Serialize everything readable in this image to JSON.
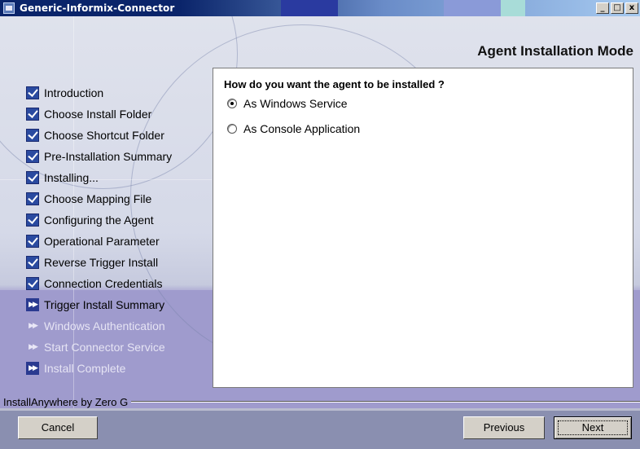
{
  "window": {
    "title": "Generic-Informix-Connector",
    "controls": {
      "minimize": "_",
      "maximize": "□",
      "close": "x"
    }
  },
  "page": {
    "heading": "Agent Installation Mode"
  },
  "steps": [
    {
      "label": "Introduction",
      "state": "done",
      "icon": "check-icon"
    },
    {
      "label": "Choose Install Folder",
      "state": "done",
      "icon": "check-icon"
    },
    {
      "label": "Choose Shortcut Folder",
      "state": "done",
      "icon": "check-icon"
    },
    {
      "label": "Pre-Installation Summary",
      "state": "done",
      "icon": "check-icon"
    },
    {
      "label": "Installing...",
      "state": "done",
      "icon": "check-icon"
    },
    {
      "label": "Choose Mapping File",
      "state": "done",
      "icon": "check-icon"
    },
    {
      "label": "Configuring the Agent",
      "state": "done",
      "icon": "check-icon"
    },
    {
      "label": "Operational Parameter",
      "state": "done",
      "icon": "check-icon"
    },
    {
      "label": "Reverse Trigger Install",
      "state": "done",
      "icon": "check-icon"
    },
    {
      "label": "Connection Credentials",
      "state": "done",
      "icon": "check-icon"
    },
    {
      "label": "Trigger Install Summary",
      "state": "current",
      "icon": "double-arrow-icon"
    },
    {
      "label": "Windows Authentication",
      "state": "pending",
      "icon": "double-arrow-icon"
    },
    {
      "label": "Start Connector Service",
      "state": "pending",
      "icon": "double-arrow-icon"
    },
    {
      "label": "Install Complete",
      "state": "pending",
      "icon": "double-arrow-icon"
    }
  ],
  "content": {
    "question": "How do you want the agent to be installed ?",
    "options": [
      {
        "label": "As Windows Service",
        "selected": true
      },
      {
        "label": "As Console Application",
        "selected": false
      }
    ]
  },
  "footer": {
    "vendor": "InstallAnywhere by Zero G",
    "cancel_label": "Cancel",
    "previous_label": "Previous",
    "next_label": "Next"
  },
  "colors": {
    "titlebar_dark": "#0a246a",
    "titlebar_light": "#a6caf0",
    "steps_lower_band": "#9f9bcd",
    "check_icon": "#2a4aa0"
  }
}
